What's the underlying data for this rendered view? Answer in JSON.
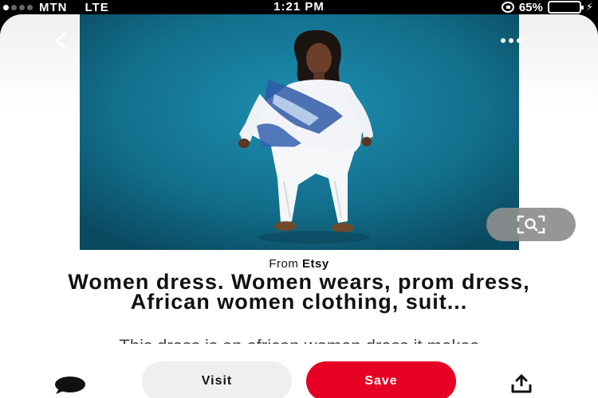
{
  "status_bar": {
    "carrier": "MTN",
    "network": "LTE",
    "time": "1:21 PM",
    "battery_percent": "65%",
    "battery_level": 0.65,
    "battery_color": "#f5c518",
    "icons": [
      "signal-icon",
      "rotation-lock-icon",
      "battery-icon",
      "charging-bolt-icon"
    ]
  },
  "pin": {
    "source_prefix": "From",
    "source_name": "Etsy",
    "title": "Women dress. Women wears, prom dress, African women clothing, suit...",
    "description": "This dress is an african women dress it makes"
  },
  "actions": {
    "visit_label": "Visit",
    "save_label": "Save"
  },
  "colors": {
    "save_button": "#e60023",
    "visit_button": "#efefef",
    "image_background": "#126d89"
  },
  "icons": {
    "back": "chevron-left-icon",
    "more": "more-dots-icon",
    "visual_search": "lens-search-icon",
    "comment": "comment-bubble-icon",
    "share": "share-upload-icon"
  }
}
